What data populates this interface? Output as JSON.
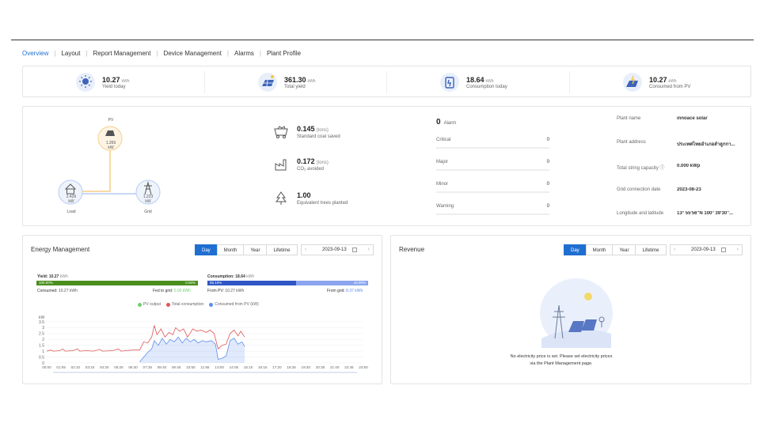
{
  "nav": {
    "items": [
      "Overview",
      "Layout",
      "Report Management",
      "Device Management",
      "Alarms",
      "Plant Profile"
    ]
  },
  "kpis": [
    {
      "value": "10.27",
      "unit": "kWh",
      "label": "Yield today",
      "icon": "sun-panel-icon"
    },
    {
      "value": "361.30",
      "unit": "kWh",
      "label": "Total yield",
      "icon": "solar-panel-icon"
    },
    {
      "value": "18.64",
      "unit": "kWh",
      "label": "Consumption today",
      "icon": "plug-icon"
    },
    {
      "value": "10.27",
      "unit": "kWh",
      "label": "Consumed from PV",
      "icon": "pv-consumption-icon"
    }
  ],
  "flow": {
    "pv": {
      "label": "PV",
      "value": "1.265",
      "unit": "kW"
    },
    "load": {
      "label": "Load",
      "value": "2.426",
      "unit": "kW"
    },
    "grid": {
      "label": "Grid",
      "value": "1.223",
      "unit": "kW"
    }
  },
  "environment": [
    {
      "value": "0.145",
      "unit": "(tons)",
      "label": "Standard coal saved",
      "icon": "coal-cart-icon"
    },
    {
      "value": "0.172",
      "unit": "(tons)",
      "label": "CO₂ avoided",
      "icon": "factory-icon"
    },
    {
      "value": "1.00",
      "unit": "",
      "label": "Equivalent trees planted",
      "icon": "tree-icon"
    }
  ],
  "alarms": {
    "total": "0",
    "word": "Alarm",
    "rows": [
      {
        "label": "Critical",
        "count": "0"
      },
      {
        "label": "Major",
        "count": "0"
      },
      {
        "label": "Minor",
        "count": "0"
      },
      {
        "label": "Warning",
        "count": "0"
      }
    ]
  },
  "plant_info": [
    {
      "key": "Plant name",
      "value": "innoace solar"
    },
    {
      "key": "Plant address",
      "value": "ประเทศไทยอำเภอลำลูกกา..."
    },
    {
      "key": "Total string capacity",
      "value": "0.000 kWp"
    },
    {
      "key": "Grid connection date",
      "value": "2023-08-23"
    },
    {
      "key": "Longitude and latitude",
      "value": "13° 55'56\"N   100° 39'30\"..."
    }
  ],
  "energy": {
    "title": "Energy Management",
    "periods": [
      "Day",
      "Month",
      "Year",
      "Lifetime"
    ],
    "active_period": "Day",
    "date": "2023-09-13",
    "yield_label": "Yield:",
    "yield_value": "10.27",
    "yield_unit": "kWh",
    "yield_pct_left": "100.00%",
    "yield_pct_right": "0.00%",
    "consumed_label": "Consumed:",
    "consumed_value": "10.27 kWh",
    "fed_label": "Fed to grid:",
    "fed_value": "0.00 kWh",
    "consumption_label": "Consumption:",
    "consumption_value": "18.64",
    "consumption_unit": "kWh",
    "cons_pct_left": "55.10%",
    "cons_pct_right": "44.90%",
    "from_pv_label": "From PV:",
    "from_pv_value": "10.27 kWh",
    "from_grid_label": "From grid:",
    "from_grid_value": "8.37 kWh",
    "colors": {
      "green": "#4a8f1e",
      "blue": "#2f56c4",
      "lightblue": "#8aa4ee",
      "pv": "#6fcf6f",
      "consumption": "#e05555",
      "fromPV": "#5b8def"
    }
  },
  "chart_data": {
    "type": "line",
    "ylabel": "kW",
    "ylim": [
      0,
      3.5
    ],
    "yticks": [
      "0",
      "0.5",
      "1",
      "1.5",
      "2",
      "2.5",
      "3",
      "3.5"
    ],
    "xticks": [
      "00:00",
      "01:05",
      "02:10",
      "03:15",
      "04:20",
      "05:25",
      "06:30",
      "07:35",
      "08:40",
      "09:45",
      "10:50",
      "11:55",
      "13:00",
      "14:05",
      "15:10",
      "16:15",
      "17:20",
      "18:25",
      "19:30",
      "20:35",
      "21:40",
      "22:45",
      "23:50"
    ],
    "series": [
      {
        "name": "PV output",
        "color": "#6fcf6f",
        "values": []
      },
      {
        "name": "Total consumption",
        "color": "#e05555",
        "points": [
          [
            0,
            1.0
          ],
          [
            0.3,
            1.1
          ],
          [
            0.5,
            1.0
          ],
          [
            1.0,
            1.05
          ],
          [
            1.2,
            1.2
          ],
          [
            1.4,
            1.0
          ],
          [
            2,
            1.05
          ],
          [
            2.3,
            1.2
          ],
          [
            2.5,
            1.0
          ],
          [
            3,
            1.05
          ],
          [
            3.5,
            1.0
          ],
          [
            4,
            1.15
          ],
          [
            4.2,
            1.0
          ],
          [
            5,
            1.05
          ],
          [
            5.4,
            1.2
          ],
          [
            5.6,
            1.0
          ],
          [
            6,
            1.05
          ],
          [
            6.5,
            1.1
          ],
          [
            7,
            1.1
          ],
          [
            7.3,
            1.8
          ],
          [
            7.6,
            1.7
          ],
          [
            7.9,
            2.2
          ],
          [
            8.1,
            3.2
          ],
          [
            8.3,
            2.4
          ],
          [
            8.6,
            2.9
          ],
          [
            8.9,
            2.2
          ],
          [
            9.2,
            2.6
          ],
          [
            9.5,
            2.4
          ],
          [
            9.7,
            3.0
          ],
          [
            10,
            2.7
          ],
          [
            10.3,
            2.9
          ],
          [
            10.6,
            2.2
          ],
          [
            11,
            2.9
          ],
          [
            11.3,
            2.7
          ],
          [
            11.6,
            2.8
          ],
          [
            12,
            2.6
          ],
          [
            12.3,
            2.8
          ],
          [
            12.6,
            2.5
          ],
          [
            12.9,
            1.2
          ],
          [
            13.2,
            1.5
          ],
          [
            13.5,
            1.6
          ],
          [
            13.8,
            2.5
          ],
          [
            14.1,
            2.8
          ],
          [
            14.4,
            2.3
          ],
          [
            14.6,
            2.7
          ],
          [
            14.9,
            2.2
          ]
        ]
      },
      {
        "name": "Consumed from PV (kW)",
        "color": "#5b8def",
        "points": [
          [
            7,
            0.1
          ],
          [
            7.3,
            0.5
          ],
          [
            7.6,
            0.9
          ],
          [
            7.9,
            1.2
          ],
          [
            8.1,
            1.9
          ],
          [
            8.4,
            1.5
          ],
          [
            8.7,
            2.1
          ],
          [
            9.0,
            1.6
          ],
          [
            9.3,
            2.0
          ],
          [
            9.6,
            1.8
          ],
          [
            9.9,
            2.2
          ],
          [
            10.2,
            1.7
          ],
          [
            10.5,
            2.1
          ],
          [
            10.8,
            1.8
          ],
          [
            11.1,
            2.0
          ],
          [
            11.4,
            1.7
          ],
          [
            11.7,
            1.9
          ],
          [
            12,
            1.8
          ],
          [
            12.4,
            1.9
          ],
          [
            12.7,
            1.6
          ],
          [
            12.9,
            0.3
          ],
          [
            13.2,
            0.4
          ],
          [
            13.5,
            0.6
          ],
          [
            13.8,
            1.9
          ],
          [
            14.1,
            2.1
          ],
          [
            14.4,
            1.6
          ],
          [
            14.7,
            1.8
          ],
          [
            14.9,
            1.4
          ]
        ]
      }
    ],
    "legend": [
      "PV output",
      "Total consumption",
      "Consumed from PV (kW)"
    ]
  },
  "revenue": {
    "title": "Revenue",
    "periods": [
      "Day",
      "Month",
      "Year",
      "Lifetime"
    ],
    "active_period": "Day",
    "date": "2023-09-13",
    "message": "No electricity price is set. Please set electricity prices via the Plant Management page."
  }
}
